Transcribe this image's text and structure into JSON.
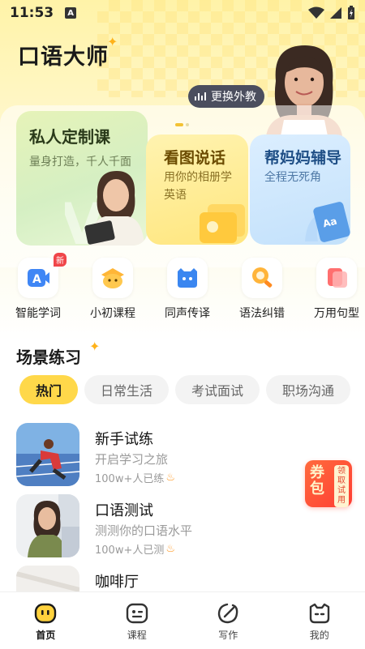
{
  "status_bar": {
    "time": "11:53",
    "notification_letter": "A"
  },
  "header": {
    "app_title": "口语大师",
    "switch_teacher_label": "更换外教"
  },
  "feature_cards": [
    {
      "title": "私人定制课",
      "subtitle": "量身打造，千人千面"
    },
    {
      "title": "看图说话",
      "subtitle": "用你的相册学英语"
    },
    {
      "title": "帮妈妈辅导",
      "subtitle": "全程无死角"
    }
  ],
  "tools": [
    {
      "label": "智能学词",
      "icon": "smart-vocab-icon",
      "badge": "新"
    },
    {
      "label": "小初课程",
      "icon": "junior-course-icon"
    },
    {
      "label": "同声传译",
      "icon": "interpret-icon"
    },
    {
      "label": "语法纠错",
      "icon": "grammar-check-icon"
    },
    {
      "label": "万用句型",
      "icon": "sentence-pattern-icon"
    }
  ],
  "scene_section": {
    "title": "场景练习",
    "tabs": [
      "热门",
      "日常生活",
      "考试面试",
      "职场沟通"
    ],
    "items": [
      {
        "title": "新手试练",
        "subtitle": "开启学习之旅",
        "meta": "100w+人已练"
      },
      {
        "title": "口语测试",
        "subtitle": "测测你的口语水平",
        "meta": "100w+人已测"
      },
      {
        "title": "咖啡厅",
        "subtitle": "",
        "meta": ""
      }
    ]
  },
  "coupon": {
    "main": "券包",
    "tag": "领取试用"
  },
  "bottom_nav": [
    {
      "label": "首页",
      "icon": "home-icon"
    },
    {
      "label": "课程",
      "icon": "course-icon"
    },
    {
      "label": "写作",
      "icon": "writing-icon"
    },
    {
      "label": "我的",
      "icon": "profile-icon"
    }
  ],
  "colors": {
    "accent": "#ffd84a",
    "badge": "#f0464a",
    "coupon": "#ff4a34"
  }
}
